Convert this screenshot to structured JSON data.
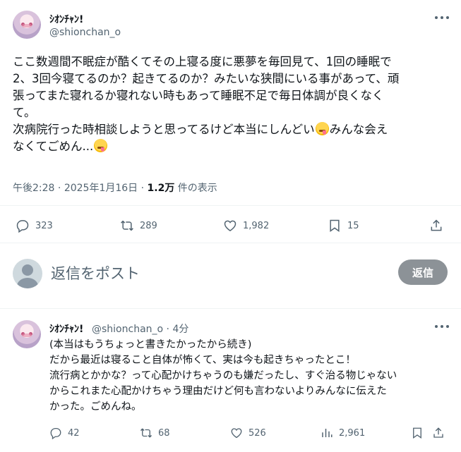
{
  "main_post": {
    "display_name": "ｼｵﾝﾁｬﾝ!",
    "handle": "@shionchan_o",
    "lines": [
      "ここ数週間不眠症が酷くてその上寝る度に悪夢を毎回見て、1回の睡眠で",
      "2、3回今寝てるのか？起きてるのか？みたいな狭間にいる事があって、頑",
      "張ってまた寝れるか寝れない時もあって睡眠不足で毎日体調が良くなく",
      "て。",
      "次病院行った時相談しようと思ってるけど本当にしんどい",
      "みんな会え",
      "なくてごめん...",
      ""
    ],
    "time": "午後2:28",
    "date": "2025年1月16日",
    "views_count": "1.2万",
    "views_label": "件の表示",
    "replies": "323",
    "reposts": "289",
    "likes": "1,982",
    "bookmarks": "15"
  },
  "reply_composer": {
    "placeholder": "返信をポスト",
    "button_label": "返信"
  },
  "reply_post": {
    "display_name": "ｼｵﾝﾁｬﾝ!",
    "handle": "@shionchan_o",
    "time_ago": "4分",
    "lines": [
      "(本当はもうちょっと書きたかったから続き)",
      "だから最近は寝ること自体が怖くて、実は今も起きちゃったとこ！",
      "流行病とかかな？って心配かけちゃうのも嫌だったし、すぐ治る物じゃない",
      "からこれまた心配かけちゃう理由だけど何も言わないよりみんなに伝えた",
      "かった。ごめんね。"
    ],
    "replies": "42",
    "reposts": "68",
    "likes": "526",
    "views": "2,961"
  },
  "icons": {
    "reply": "reply-icon",
    "repost": "repost-icon",
    "like": "heart-icon",
    "bookmark": "bookmark-icon",
    "share": "share-icon",
    "views": "views-icon",
    "more": "more-icon",
    "emoji": "drooling-face-emoji"
  },
  "colors": {
    "text": "#0f1419",
    "secondary": "#536471",
    "divider": "#eff3f4",
    "reply_button": "#8c9297"
  }
}
